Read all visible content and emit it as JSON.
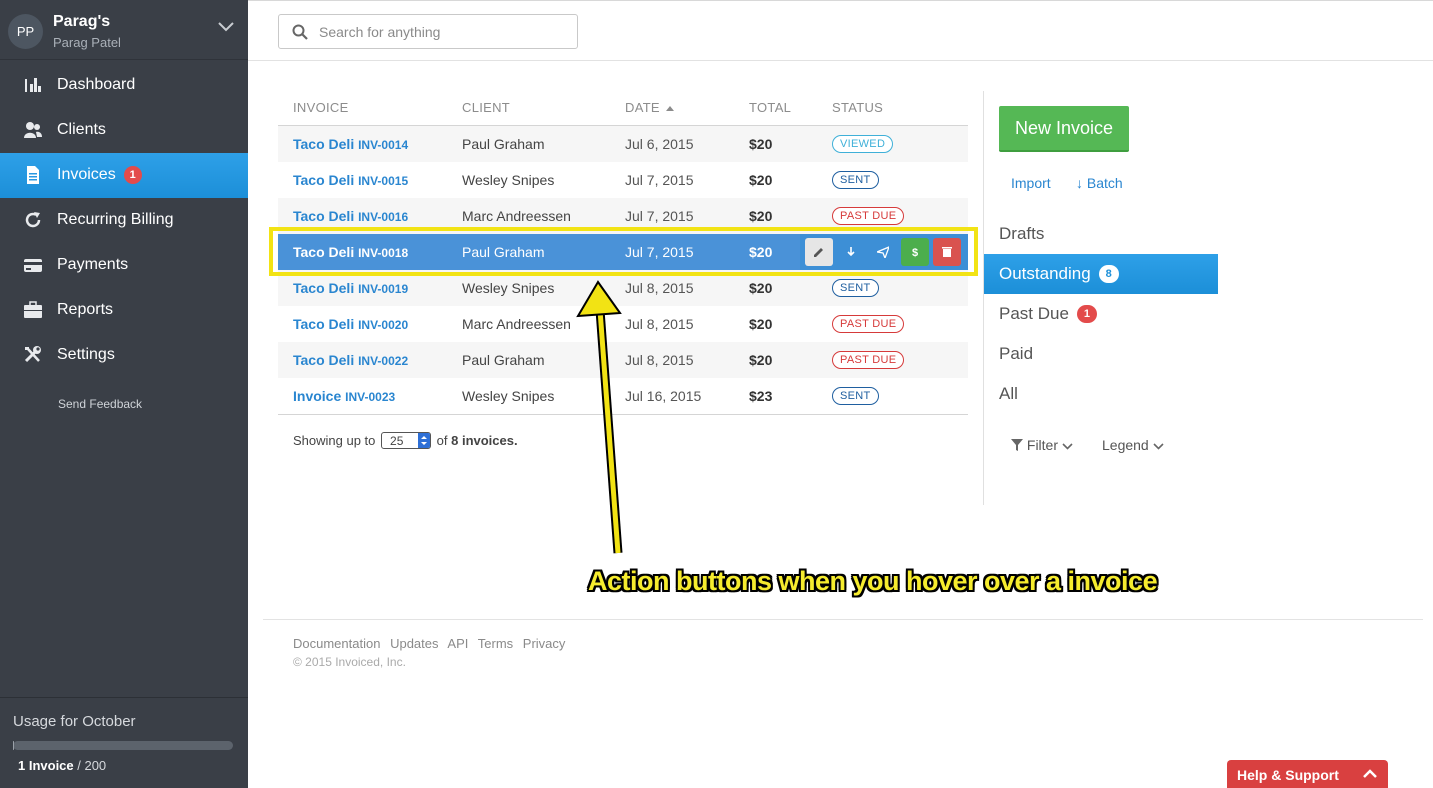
{
  "account": {
    "initials": "PP",
    "name": "Parag's",
    "user": "Parag Patel"
  },
  "nav": [
    {
      "label": "Dashboard",
      "icon": "bar-chart-icon"
    },
    {
      "label": "Clients",
      "icon": "users-icon"
    },
    {
      "label": "Invoices",
      "icon": "document-icon",
      "badge": "1",
      "active": true
    },
    {
      "label": "Recurring Billing",
      "icon": "refresh-icon"
    },
    {
      "label": "Payments",
      "icon": "credit-card-icon"
    },
    {
      "label": "Reports",
      "icon": "briefcase-icon"
    },
    {
      "label": "Settings",
      "icon": "tools-icon"
    }
  ],
  "feedback": "Send Feedback",
  "usage": {
    "title": "Usage for October",
    "used": "1 Invoice",
    "limit": " / 200",
    "fraction": 0.005
  },
  "search": {
    "placeholder": "Search for anything"
  },
  "table": {
    "headers": {
      "invoice": "INVOICE",
      "client": "CLIENT",
      "date": "DATE",
      "total": "TOTAL",
      "status": "STATUS"
    },
    "rows": [
      {
        "name": "Taco Deli",
        "number": "INV-0014",
        "client": "Paul Graham",
        "date": "Jul 6, 2015",
        "total": "$20",
        "status": "VIEWED",
        "status_type": "viewed"
      },
      {
        "name": "Taco Deli",
        "number": "INV-0015",
        "client": "Wesley Snipes",
        "date": "Jul 7, 2015",
        "total": "$20",
        "status": "SENT",
        "status_type": "sent"
      },
      {
        "name": "Taco Deli",
        "number": "INV-0016",
        "client": "Marc Andreessen",
        "date": "Jul 7, 2015",
        "total": "$20",
        "status": "PAST DUE",
        "status_type": "pastdue"
      },
      {
        "name": "Taco Deli",
        "number": "INV-0018",
        "client": "Paul Graham",
        "date": "Jul 7, 2015",
        "total": "$20",
        "status": "",
        "status_type": "hover"
      },
      {
        "name": "Taco Deli",
        "number": "INV-0019",
        "client": "Wesley Snipes",
        "date": "Jul 8, 2015",
        "total": "$20",
        "status": "SENT",
        "status_type": "sent"
      },
      {
        "name": "Taco Deli",
        "number": "INV-0020",
        "client": "Marc Andreessen",
        "date": "Jul 8, 2015",
        "total": "$20",
        "status": "PAST DUE",
        "status_type": "pastdue"
      },
      {
        "name": "Taco Deli",
        "number": "INV-0022",
        "client": "Paul Graham",
        "date": "Jul 8, 2015",
        "total": "$20",
        "status": "PAST DUE",
        "status_type": "pastdue"
      },
      {
        "name": "Invoice",
        "number": "INV-0023",
        "client": "Wesley Snipes",
        "date": "Jul 16, 2015",
        "total": "$23",
        "status": "SENT",
        "status_type": "sent"
      }
    ],
    "showing_prefix": "Showing up to",
    "per_page": "25",
    "showing_suffix": " of ",
    "showing_count": "8 invoices."
  },
  "actions": [
    {
      "name": "edit-button",
      "icon": "pencil-icon",
      "color": "#e6e6e6"
    },
    {
      "name": "download-button",
      "icon": "download-icon",
      "color": "#3d8fd6"
    },
    {
      "name": "send-button",
      "icon": "paper-plane-icon",
      "color": "#3d8fd6"
    },
    {
      "name": "record-payment-button",
      "icon": "dollar-icon",
      "color": "#4cae4c"
    },
    {
      "name": "delete-button",
      "icon": "trash-icon",
      "color": "#d9534f"
    }
  ],
  "panel": {
    "new_invoice": "New Invoice",
    "import": "Import",
    "batch": "↓ Batch",
    "filters": [
      {
        "label": "Drafts",
        "count": ""
      },
      {
        "label": "Outstanding",
        "count": "8",
        "active": true
      },
      {
        "label": "Past Due",
        "count": "1"
      },
      {
        "label": "Paid",
        "count": ""
      },
      {
        "label": "All",
        "count": ""
      }
    ],
    "filter_label": "Filter",
    "legend_label": "Legend"
  },
  "annotation": "Action buttons when you hover over a invoice",
  "footer": {
    "links": [
      "Documentation",
      "Updates",
      "API",
      "Terms",
      "Privacy"
    ],
    "copyright": "© 2015 Invoiced, Inc."
  },
  "help": "Help & Support",
  "colors": {
    "sidebar": "#3a3f47",
    "accent": "#1c8fd8",
    "green": "#55b855",
    "red": "#d94040",
    "highlight": "#f2e314"
  }
}
